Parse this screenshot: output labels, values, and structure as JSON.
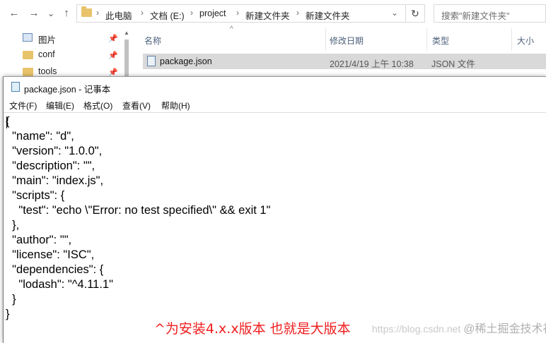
{
  "explorer": {
    "nav": {
      "back": "←",
      "forward": "→",
      "recent": "⌄",
      "up": "↑"
    },
    "breadcrumb": [
      "此电脑",
      "文档 (E:)",
      "project",
      "新建文件夹",
      "新建文件夹"
    ],
    "breadcrumb_sep": "›",
    "search_placeholder": "搜索\"新建文件夹\"",
    "sidebar": [
      {
        "label": "图片",
        "icon": "pictures-icon"
      },
      {
        "label": "conf",
        "icon": "folder-icon"
      },
      {
        "label": "tools",
        "icon": "folder-icon"
      }
    ],
    "columns": {
      "name": "名称",
      "modified": "修改日期",
      "type": "类型",
      "size": "大小"
    },
    "files": [
      {
        "name": "package.json",
        "modified": "2021/4/19 上午 10:38",
        "type": "JSON 文件"
      }
    ]
  },
  "notepad": {
    "title": "package.json - 记事本",
    "menu": [
      "文件(F)",
      "编辑(E)",
      "格式(O)",
      "查看(V)",
      "帮助(H)"
    ],
    "content": "{\n  \"name\": \"d\",\n  \"version\": \"1.0.0\",\n  \"description\": \"\",\n  \"main\": \"index.js\",\n  \"scripts\": {\n    \"test\": \"echo \\\"Error: no test specified\\\" && exit 1\"\n  },\n  \"author\": \"\",\n  \"license\": \"ISC\",\n  \"dependencies\": {\n    \"lodash\": \"^4.11.1\"\n  }\n}"
  },
  "annotation": "^为安装4.x.x版本 也就是大版本",
  "watermark": {
    "url": "https://blog.csdn.net",
    "brand": "@稀土掘金技术社区"
  },
  "colors": {
    "annotation": "#f01e1e",
    "selected_row": "#d9d9d9",
    "folder": "#e9c36a"
  }
}
